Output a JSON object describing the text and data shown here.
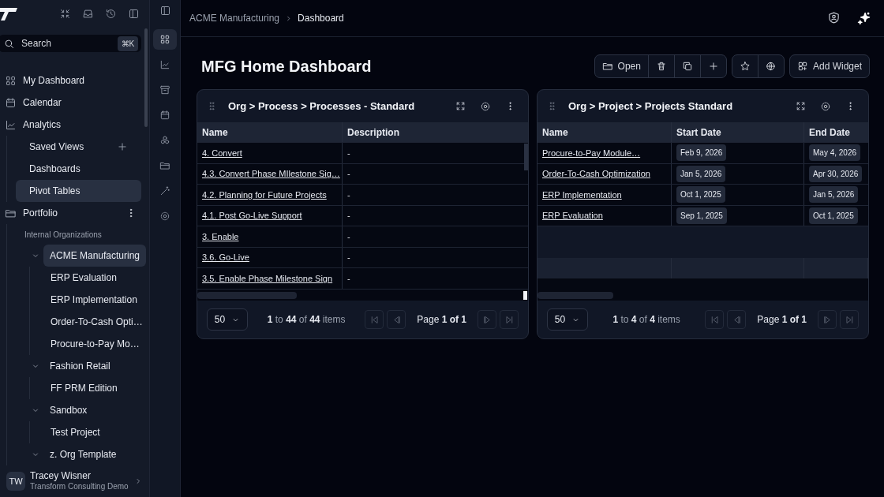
{
  "sidebar": {
    "search": {
      "placeholder": "Search",
      "shortcut": "⌘K"
    },
    "nav": [
      {
        "label": "My Dashboard",
        "kind": "dashboard"
      },
      {
        "label": "Calendar",
        "kind": "calendar"
      },
      {
        "label": "Analytics",
        "kind": "analytics",
        "children": [
          {
            "label": "Saved Views",
            "add_button": true,
            "selected": false
          },
          {
            "label": "Dashboards",
            "selected": false
          },
          {
            "label": "Pivot Tables",
            "selected": true
          }
        ]
      },
      {
        "label": "Portfolio",
        "kind": "portfolio",
        "menu_button": true,
        "section": "Internal Organizations",
        "children": [
          {
            "label": "ACME Manufacturing",
            "expanded": true,
            "selected": true,
            "children": [
              {
                "label": "ERP Evaluation",
                "selected": false
              },
              {
                "label": "ERP Implementation",
                "selected": false
              },
              {
                "label": "Order-To-Cash Opti…",
                "selected": false
              },
              {
                "label": "Procure-to-Pay Mo…",
                "selected": false
              }
            ]
          },
          {
            "label": "Fashion Retail",
            "expanded": true,
            "selected": false,
            "children": [
              {
                "label": "FF PRM Edition",
                "selected": false
              }
            ]
          },
          {
            "label": "Sandbox",
            "expanded": true,
            "selected": false,
            "children": [
              {
                "label": "Test Project",
                "selected": false
              }
            ]
          },
          {
            "label": "z. Org Template",
            "expanded": true,
            "selected": false
          }
        ]
      }
    ],
    "user": {
      "initials": "TW",
      "name": "Tracey Wisner",
      "org": "Transform Consulting Demo"
    }
  },
  "rail": [
    {
      "kind": "dashboard",
      "selected": true
    },
    {
      "kind": "analytics",
      "selected": false
    },
    {
      "kind": "archive",
      "selected": false
    },
    {
      "kind": "calendar",
      "selected": false
    },
    {
      "kind": "cubes",
      "selected": false
    },
    {
      "kind": "portfolio",
      "selected": false
    },
    {
      "kind": "wand",
      "selected": false
    },
    {
      "kind": "settings",
      "selected": false
    }
  ],
  "header": {
    "breadcrumb": [
      "ACME Manufacturing",
      "Dashboard"
    ]
  },
  "page": {
    "title": "MFG Home Dashboard",
    "toolbar": [
      [
        {
          "kind": "open",
          "label": "Open"
        },
        {
          "kind": "delete"
        },
        {
          "kind": "copy"
        },
        {
          "kind": "add"
        }
      ],
      [
        {
          "kind": "favorite"
        },
        {
          "kind": "globe"
        }
      ],
      [
        {
          "kind": "add_widget",
          "label": "Add Widget"
        }
      ]
    ]
  },
  "widgets": [
    {
      "title": "Org > Process > Processes - Standard",
      "columns": [
        {
          "label": "Name",
          "kind": "link"
        },
        {
          "label": "Description",
          "kind": "text"
        }
      ],
      "rows": [
        [
          "4. Convert",
          "-"
        ],
        [
          "4.3. Convert Phase MIlestone Sig…",
          "-"
        ],
        [
          "4.2. Planning for Future Projects",
          "-"
        ],
        [
          "4.1. Post Go-Live Support",
          "-"
        ],
        [
          "3. Enable",
          "-"
        ],
        [
          "3.6. Go-Live",
          "-"
        ],
        [
          "3.5. Enable Phase Milestone Sign",
          "-"
        ]
      ],
      "page_size": "50",
      "range": "**1** to **44** of **44** items",
      "page": "Page **1 of 1**",
      "nav_buttons": [
        {
          "kind": "first",
          "disabled": true
        },
        {
          "kind": "prev",
          "disabled": true
        },
        {
          "kind": "next",
          "disabled": true
        },
        {
          "kind": "last",
          "disabled": true
        }
      ]
    },
    {
      "title": "Org > Project > Projects Standard",
      "columns": [
        {
          "label": "Name",
          "kind": "link"
        },
        {
          "label": "Start Date",
          "kind": "date"
        },
        {
          "label": "End Date",
          "kind": "date"
        }
      ],
      "rows": [
        [
          "Procure-to-Pay Module…",
          "Feb 9, 2026",
          "May 4, 2026"
        ],
        [
          "Order-To-Cash Optimization",
          "Jan 5, 2026",
          "Apr 30, 2026"
        ],
        [
          "ERP Implementation",
          "Oct 1, 2025",
          "Jan 5, 2026"
        ],
        [
          "ERP Evaluation",
          "Sep 1, 2025",
          "Oct 1, 2025"
        ]
      ],
      "page_size": "50",
      "range": "**1** to **4** of **4** items",
      "page": "Page **1 of 1**",
      "nav_buttons": [
        {
          "kind": "first",
          "disabled": true
        },
        {
          "kind": "prev",
          "disabled": true
        },
        {
          "kind": "next",
          "disabled": true
        },
        {
          "kind": "last",
          "disabled": true
        }
      ]
    }
  ]
}
